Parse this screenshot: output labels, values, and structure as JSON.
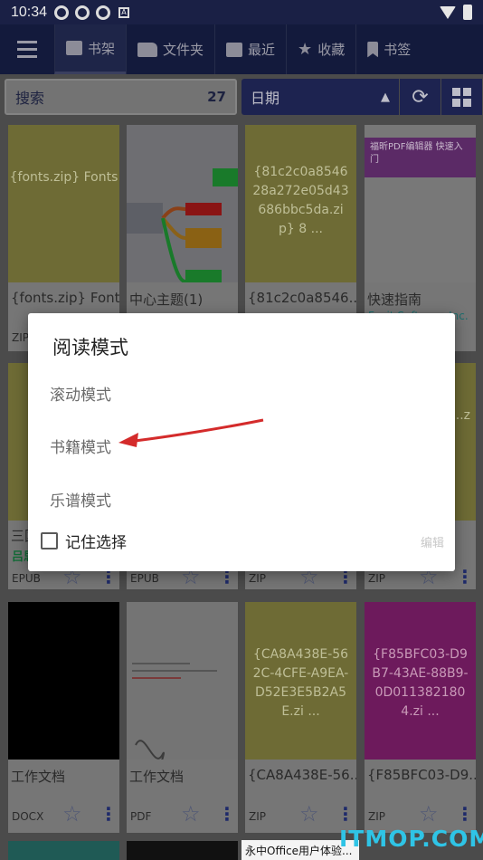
{
  "status": {
    "time": "10:34"
  },
  "nav": {
    "tabs": [
      {
        "label": "书架",
        "icon": "book-icon"
      },
      {
        "label": "文件夹",
        "icon": "folder-icon"
      },
      {
        "label": "最近",
        "icon": "recent-icon"
      },
      {
        "label": "收藏",
        "icon": "star-icon"
      },
      {
        "label": "书签",
        "icon": "bookmark-icon"
      }
    ]
  },
  "search": {
    "placeholder": "搜索",
    "count": "27"
  },
  "sort": {
    "label": "日期"
  },
  "books": [
    {
      "cover_text": "{fonts.zip} Fonts",
      "title": "{fonts.zip} Fonts",
      "type": "ZIP"
    },
    {
      "cover_text": "",
      "title": "中心主题(1)",
      "type": ""
    },
    {
      "cover_text": "{81c2c0a854628a272e05d43686bbc5da.zip} 8 ...",
      "title": "{81c2c0a8546...",
      "type": ""
    },
    {
      "cover_text": "福昕PDF编辑器 快速入门",
      "title": "快速指南",
      "subtitle": "Foxit Software Inc.",
      "type": ""
    },
    {
      "cover_text": "",
      "title": "三国",
      "subtitle": "吕思",
      "type": "EPUB"
    },
    {
      "cover_text": "",
      "title": "",
      "type": "EPUB"
    },
    {
      "cover_text": "",
      "title": "",
      "type": "ZIP"
    },
    {
      "cover_text": "...56 ...z",
      "title": "",
      "type": "ZIP"
    },
    {
      "cover_text": "",
      "title": "工作文档",
      "type": "DOCX"
    },
    {
      "cover_text": "",
      "title": "工作文档",
      "type": "PDF"
    },
    {
      "cover_text": "{CA8A438E-562C-4CFE-A9EA-D52E3E5B2A5E.zi ...",
      "title": "{CA8A438E-56...",
      "type": "ZIP"
    },
    {
      "cover_text": "{F85BFC03-D9B7-43AE-88B9-0D0113821804.zi ...",
      "title": "{F85BFC03-D9...",
      "type": "ZIP"
    }
  ],
  "dialog": {
    "title": "阅读模式",
    "options": [
      "滚动模式",
      "书籍模式",
      "乐谱模式"
    ],
    "remember_label": "记住选择",
    "edit_label": "编辑"
  },
  "bottom_strip_text": "永中Office用户体验...",
  "watermark": "ITMOP.COM",
  "colors": {
    "nav_bg": "#131a3c",
    "accent": "#1d2350",
    "arrow": "#d42b2b"
  }
}
